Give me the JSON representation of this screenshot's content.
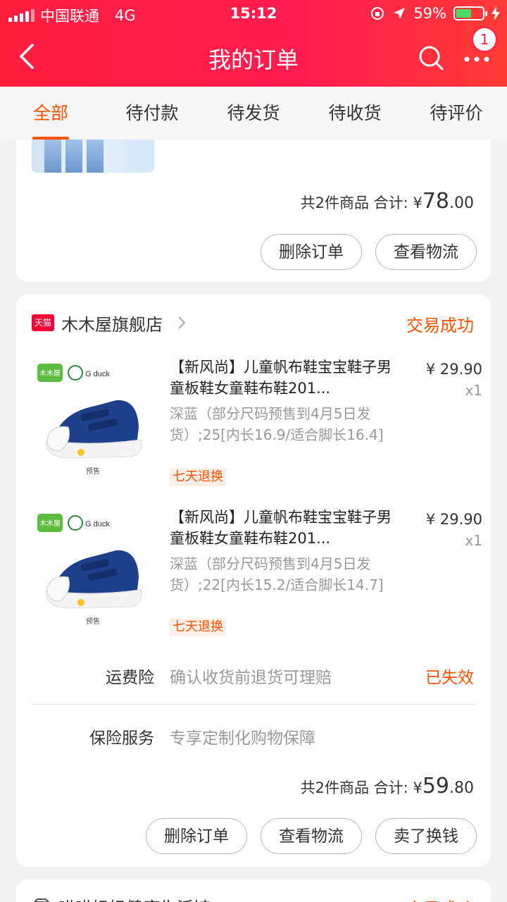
{
  "status_bar": {
    "carrier": "中国联通",
    "network": "4G",
    "time": "15:12",
    "battery": "59%",
    "battery_level": 0.59
  },
  "nav": {
    "title": "我的订单",
    "badge": "1"
  },
  "tabs": [
    "全部",
    "待付款",
    "待发货",
    "待收货",
    "待评价"
  ],
  "order1": {
    "summary_count": "共2件商品 合计:",
    "currency": "¥",
    "total_int": "78",
    "total_dec": ".00",
    "buttons": [
      "删除订单",
      "查看物流"
    ]
  },
  "order2": {
    "shop_badge": "天猫",
    "shop_name": "木木屋旗舰店",
    "status": "交易成功",
    "products": [
      {
        "title": "【新风尚】儿童帆布鞋宝宝鞋子男童板鞋女童鞋布鞋201...",
        "spec": "深蓝（部分尺码预售到4月5日发货）;25[内长16.9/适合脚长16.4]",
        "tag": "七天退换",
        "price": "¥ 29.90",
        "qty": "x1",
        "img_brand": "木木屋",
        "img_logo": "G duck",
        "img_note": "预售"
      },
      {
        "title": "【新风尚】儿童帆布鞋宝宝鞋子男童板鞋女童鞋布鞋201...",
        "spec": "深蓝（部分尺码预售到4月5日发货）;22[内长15.2/适合脚长14.7]",
        "tag": "七天退换",
        "price": "¥ 29.90",
        "qty": "x1",
        "img_brand": "木木屋",
        "img_logo": "G duck",
        "img_note": "预售"
      }
    ],
    "insurance": {
      "label": "运费险",
      "desc": "确认收货前退货可理赔",
      "status": "已失效"
    },
    "service": {
      "label": "保险服务",
      "desc": "专享定制化购物保障"
    },
    "summary_count": "共2件商品 合计:",
    "currency": "¥",
    "total_int": "59",
    "total_dec": ".80",
    "buttons": [
      "删除订单",
      "查看物流",
      "卖了换钱"
    ]
  },
  "order3": {
    "shop_name": "喵喵妈妈健康生活馆",
    "status": "交易成功"
  },
  "colors": {
    "header": "#ff1d50",
    "accent": "#ff5000"
  }
}
